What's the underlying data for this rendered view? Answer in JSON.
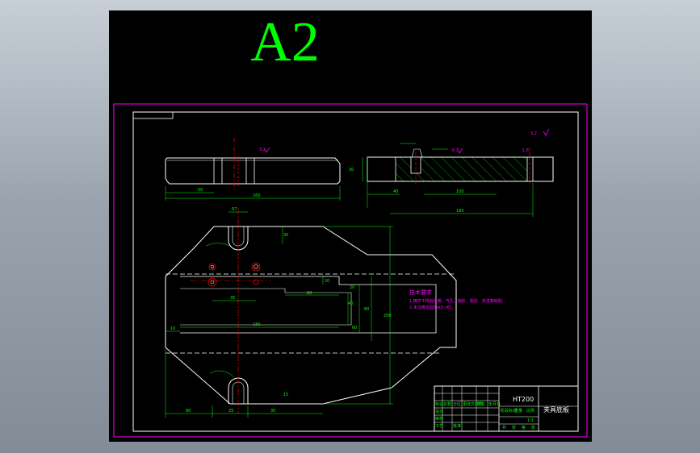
{
  "sheet": {
    "size_label": "A2"
  },
  "colors": {
    "sheet_bg": "#000000",
    "frame": "#ff00ff",
    "border": "#ffffff",
    "outline": "#ffffff",
    "dimension": "#00ff00",
    "centerline": "#ff0000",
    "hatch": "#00ff00",
    "notes": "#ff00ff",
    "holes": "#ff0000"
  },
  "dimensions": {
    "front_overall_width": "160",
    "front_left_offset": "50",
    "section_overall": "180",
    "section_inner": "100",
    "section_offset": "40",
    "section_height": "30",
    "plan_top_slot": "R7",
    "plan_top_slot_height": "30",
    "plan_overall_height": "200",
    "plan_overall_width": "180",
    "plan_mid_width": "80",
    "plan_left_offset": "10",
    "plan_height_a": "80",
    "plan_height_b": "60",
    "plan_height_c": "40",
    "plan_height_d": "20",
    "plan_bottom_left": "60",
    "plan_bottom_mid": "25",
    "plan_bottom_right": "35",
    "plan_right_margin": "15",
    "plan_inner_span": "20",
    "plan_hole_spacing": "35"
  },
  "roughness_marks": [
    "3.2",
    "3.2",
    "6.3",
    "1.6"
  ],
  "tech_notes": {
    "title": "技术要求",
    "items": [
      "1.铸件不得有砂眼、气孔、缩松、裂纹、夹渣等缺陷;",
      "2.未注铸造圆角R3~R5。"
    ]
  },
  "title_block": {
    "material": "HT200",
    "part_name": "夹具底板",
    "scale": "1:1",
    "left_headers": [
      "标记",
      "处数",
      "分区",
      "更改文件号",
      "签名",
      "年月日"
    ],
    "row_labels": [
      "设计",
      "审核",
      "工艺",
      "批准"
    ],
    "stage_headers": [
      "阶段标记",
      "重量",
      "比例"
    ],
    "bottom_labels": [
      "共",
      "张",
      "第",
      "张"
    ]
  }
}
